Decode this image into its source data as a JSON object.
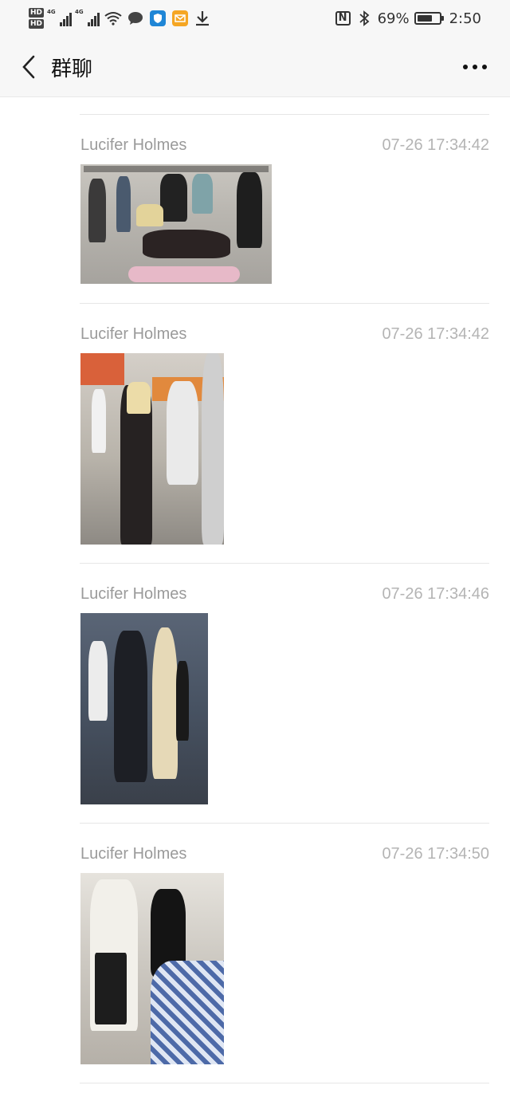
{
  "status_bar": {
    "hd1": "HD",
    "hd2": "HD",
    "sig1_tag": "4G",
    "sig2_tag": "4G",
    "battery_percent": "69%",
    "battery_level": 0.69,
    "clock": "2:50",
    "nfc_label": "N"
  },
  "header": {
    "title": "群聊"
  },
  "messages": [
    {
      "sender": "Lucifer Holmes",
      "time": "07-26 17:34:42"
    },
    {
      "sender": "Lucifer Holmes",
      "time": "07-26 17:34:42"
    },
    {
      "sender": "Lucifer Holmes",
      "time": "07-26 17:34:46"
    },
    {
      "sender": "Lucifer Holmes",
      "time": "07-26 17:34:50"
    }
  ],
  "colors": {
    "status_bg": "#f7f7f7",
    "divider": "#e6e6e6",
    "sender_text": "#9a9a9a",
    "time_text": "#b4b4b4"
  },
  "icons": [
    "chat-bubble-icon",
    "shield-app-icon",
    "mail-app-icon",
    "download-icon",
    "wifi-icon",
    "bluetooth-icon",
    "back-arrow-icon",
    "more-dots-icon"
  ]
}
